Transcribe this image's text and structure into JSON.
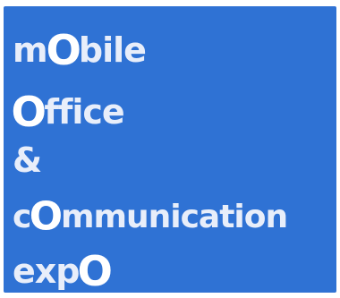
{
  "logo": {
    "colors": {
      "background": "#2f72d4",
      "text": "#e8eefa",
      "highlight": "#ffffff"
    },
    "lines": [
      {
        "before": "m",
        "o": "O",
        "after": "bile"
      },
      {
        "before": "",
        "o": "O",
        "after": "ffice"
      },
      {
        "before": "&",
        "o": "",
        "after": ""
      },
      {
        "before": "c",
        "o": "O",
        "after": "mmunication"
      },
      {
        "before": "exp",
        "o": "O",
        "after": ""
      }
    ]
  }
}
